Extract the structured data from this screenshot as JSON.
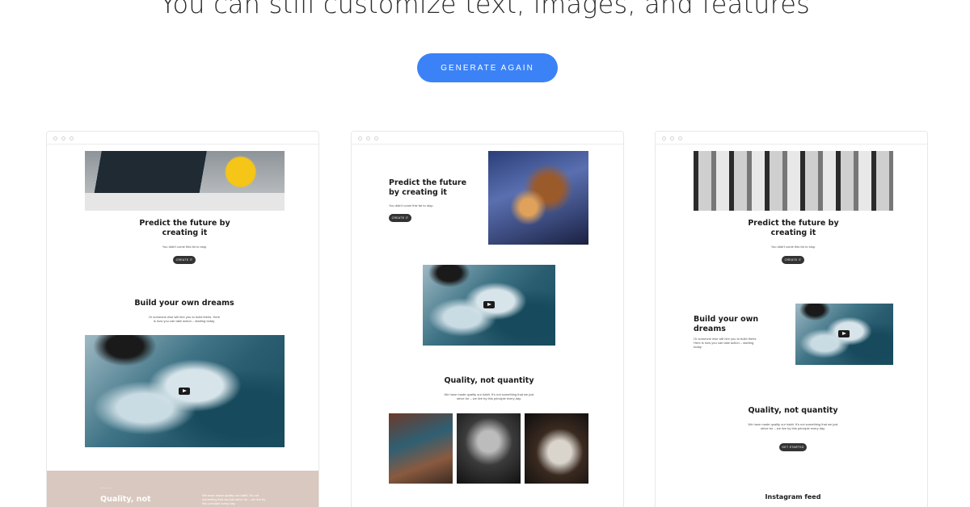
{
  "headline": "You can still customize text, images, and features",
  "generate_button": "GENERATE AGAIN",
  "colors": {
    "accent": "#3b82f6",
    "beige": "#d9c8bf"
  },
  "card1": {
    "hero_title": "Predict the future by creating it",
    "hero_sub": "You didn't come this far to stop.",
    "hero_cta": "CREATE IT",
    "section_title": "Build your own dreams",
    "section_sub": "Or someone else will hire you to build theirs. Here is how you can take action – starting today.",
    "band_eyebrow": "— — —",
    "band_title": "Quality, not",
    "band_text": "We have made quality our habit. It's not something that we just strive for – we live by this principle every day."
  },
  "card2": {
    "hero_title": "Predict the future by creating it",
    "hero_sub": "You didn't come this far to stop.",
    "hero_cta": "CREATE IT",
    "section_title": "Quality, not quantity",
    "section_sub": "We have made quality our habit. It's not something that we just strive for – we live by this principle every day."
  },
  "card3": {
    "hero_title": "Predict the future by creating it",
    "hero_sub": "You didn't come this far to stop.",
    "hero_cta": "CREATE IT",
    "section_title": "Build your own dreams",
    "section_sub": "Or someone else will hire you to build theirs. Here is how you can take action – starting today.",
    "quality_title": "Quality, not quantity",
    "quality_sub": "We have made quality our habit. It's not something that we just strive for – we live by this principle every day.",
    "quality_cta": "GET STARTED",
    "insta_title": "Instagram feed"
  }
}
